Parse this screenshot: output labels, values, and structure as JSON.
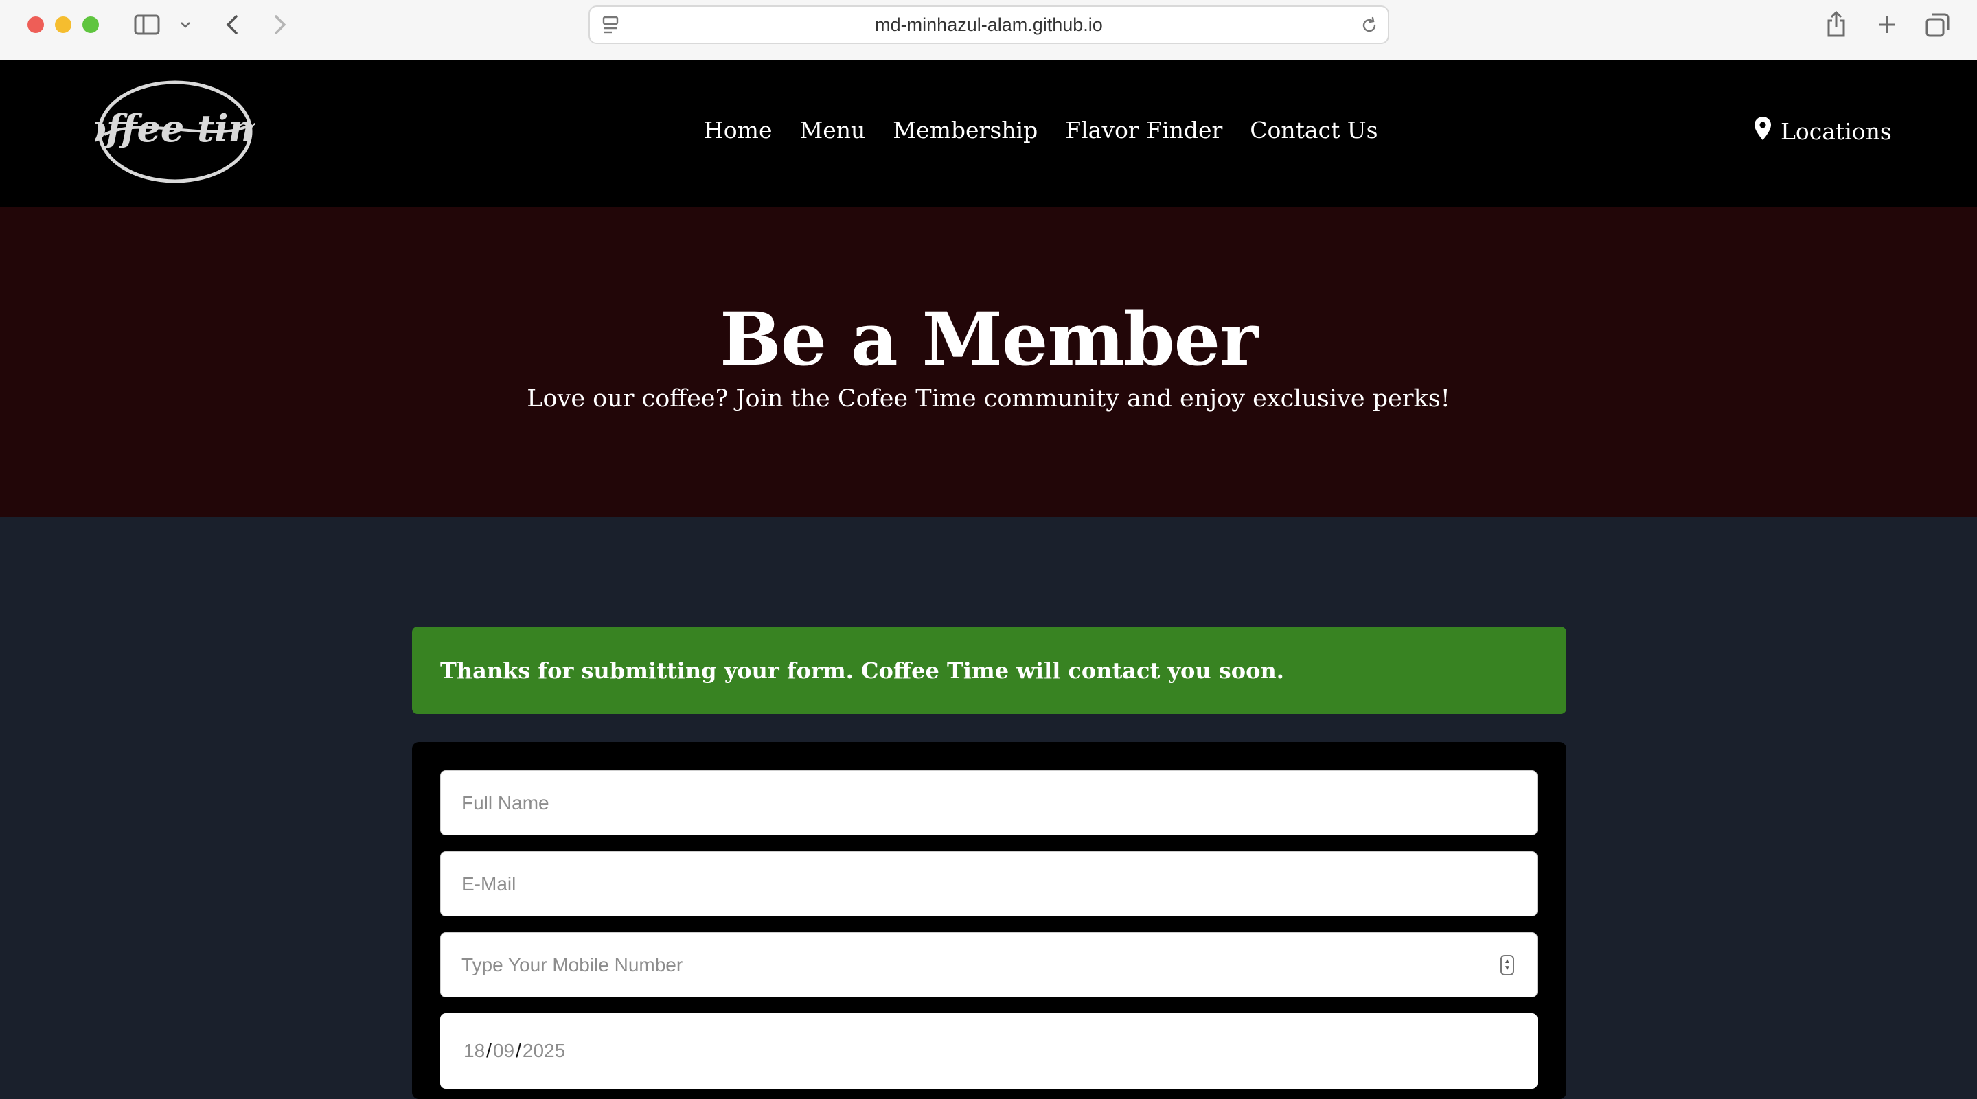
{
  "browser": {
    "url": "md-minhazul-alam.github.io"
  },
  "header": {
    "logo_text": "coffee time",
    "nav": [
      "Home",
      "Menu",
      "Membership",
      "Flavor Finder",
      "Contact Us"
    ],
    "locations_label": "Locations"
  },
  "hero": {
    "title": "Be a Member",
    "subtitle": "Love our coffee? Join the Cofee Time community and enjoy exclusive perks!"
  },
  "alert": {
    "message": "Thanks for submitting your form. Coffee Time will contact you soon."
  },
  "form": {
    "full_name_placeholder": "Full Name",
    "email_placeholder": "E-Mail",
    "mobile_placeholder": "Type Your Mobile Number",
    "date": {
      "day": "18",
      "month": "09",
      "year": "2025"
    }
  },
  "colors": {
    "header_bg": "#000000",
    "hero_bg": "#220608",
    "page_bg": "#1a202c",
    "alert_bg": "#388322"
  }
}
